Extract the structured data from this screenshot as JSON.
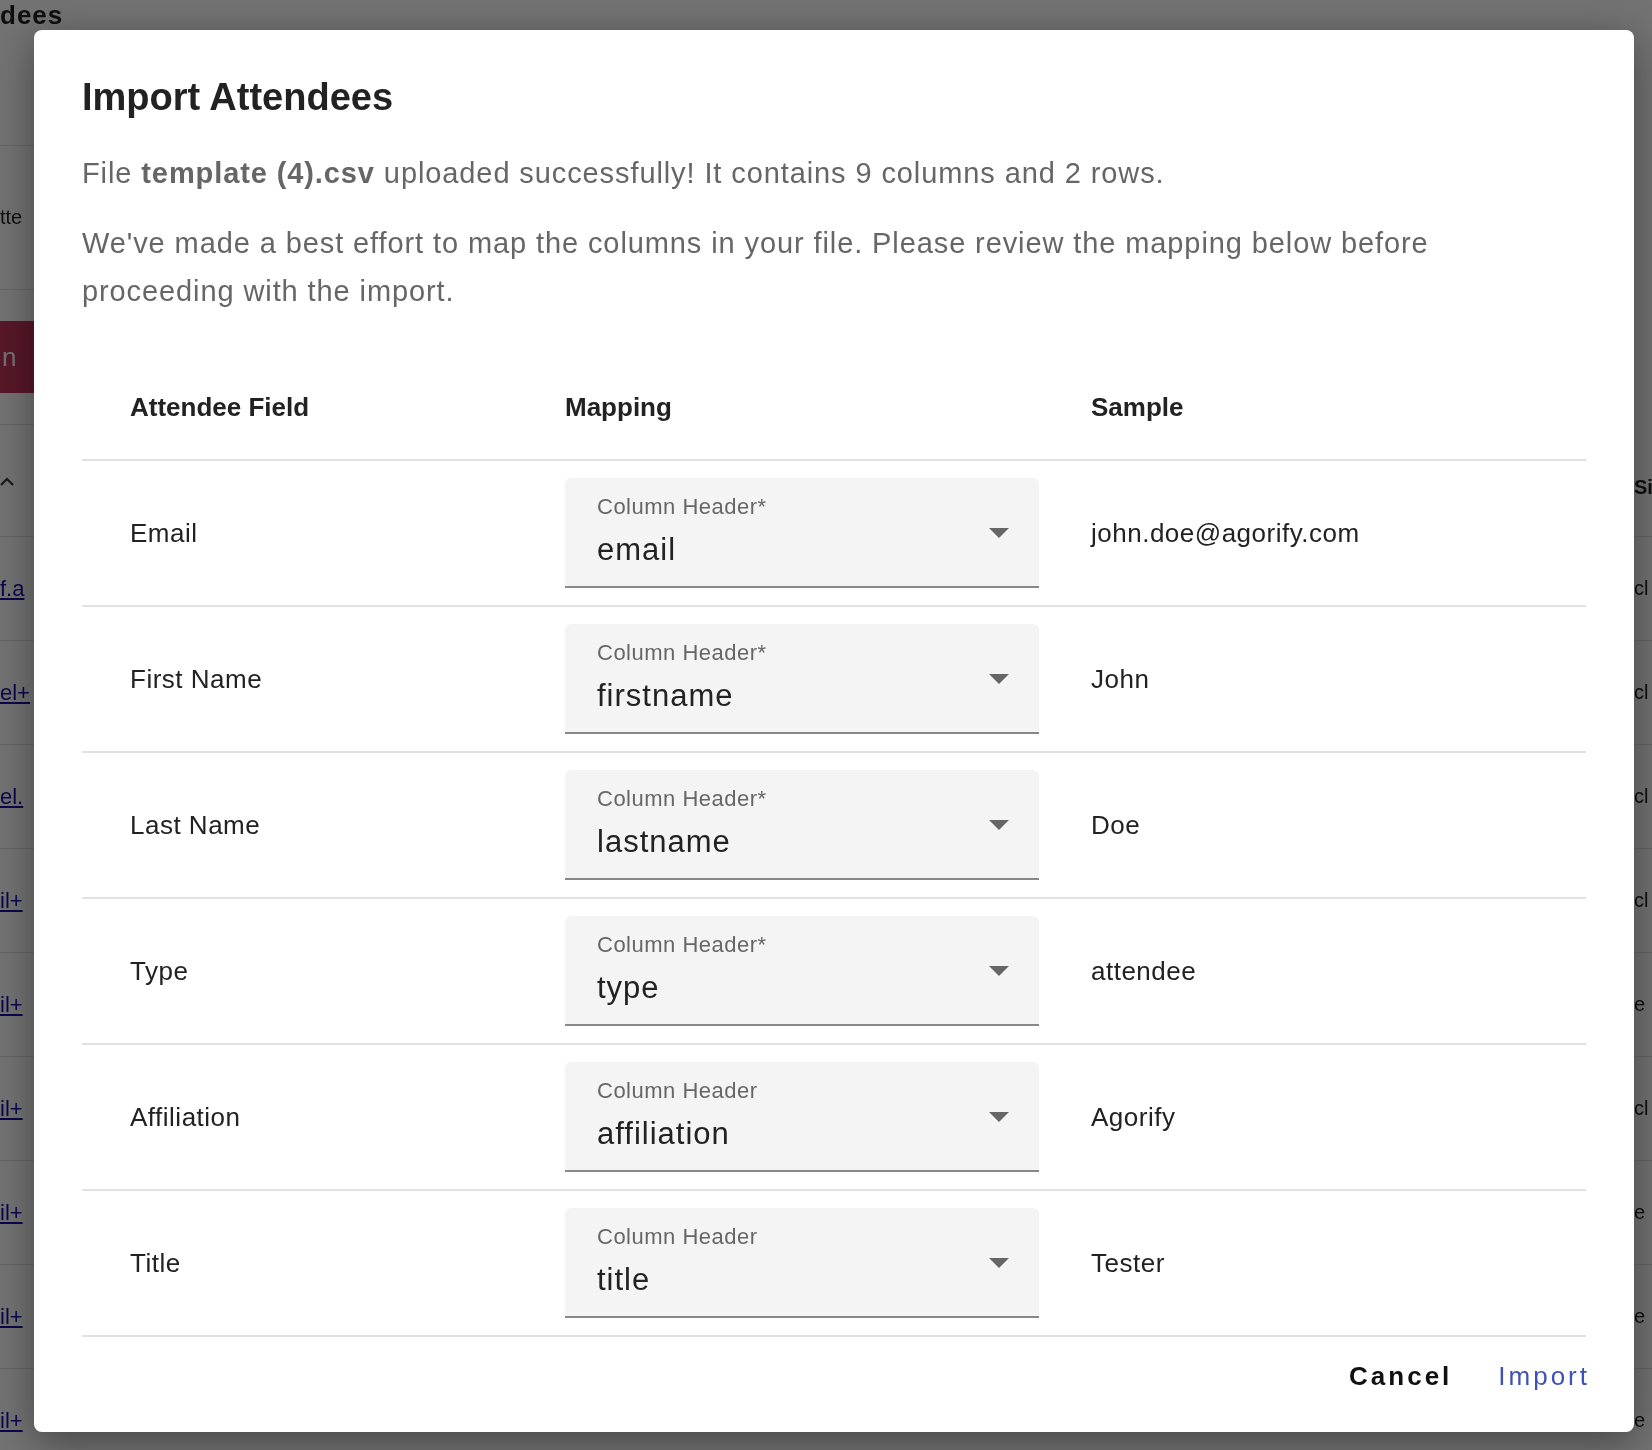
{
  "background": {
    "left": [
      {
        "kind": "heading",
        "text": "dees"
      },
      {
        "kind": "text",
        "text": "tte"
      },
      {
        "kind": "button",
        "text": "n"
      },
      {
        "kind": "chevron"
      },
      {
        "kind": "link",
        "text": "f.a"
      },
      {
        "kind": "link",
        "text": "el+"
      },
      {
        "kind": "link",
        "text": "el."
      },
      {
        "kind": "link",
        "text": "il+"
      },
      {
        "kind": "link",
        "text": "il+"
      },
      {
        "kind": "link",
        "text": "il+"
      },
      {
        "kind": "link",
        "text": "il+"
      },
      {
        "kind": "link",
        "text": "il+"
      },
      {
        "kind": "link",
        "text": "il+"
      }
    ],
    "right": [
      {
        "kind": "header",
        "text": "Si"
      },
      {
        "kind": "text",
        "text": "cl"
      },
      {
        "kind": "text",
        "text": "cl"
      },
      {
        "kind": "text",
        "text": "cl"
      },
      {
        "kind": "text",
        "text": "cl"
      },
      {
        "kind": "text",
        "text": "e"
      },
      {
        "kind": "text",
        "text": "cl"
      },
      {
        "kind": "text",
        "text": "e"
      },
      {
        "kind": "text",
        "text": "e"
      },
      {
        "kind": "text",
        "text": "e"
      }
    ]
  },
  "dialog": {
    "title": "Import Attendees",
    "message": "File **template (4).csv** uploaded successfully! It contains 9 columns and 2 rows.",
    "note": "We've made a best effort to map the columns in your file. Please review the mapping below before proceeding with the import.",
    "columns": [
      "Attendee Field",
      "Mapping",
      "Sample"
    ],
    "rows": [
      {
        "field": "Email",
        "label": "Column Header*",
        "value": "email",
        "sample": "john.doe@agorify.com"
      },
      {
        "field": "First Name",
        "label": "Column Header*",
        "value": "firstname",
        "sample": "John"
      },
      {
        "field": "Last Name",
        "label": "Column Header*",
        "value": "lastname",
        "sample": "Doe"
      },
      {
        "field": "Type",
        "label": "Column Header*",
        "value": "type",
        "sample": "attendee"
      },
      {
        "field": "Affiliation",
        "label": "Column Header",
        "value": "affiliation",
        "sample": "Agorify"
      },
      {
        "field": "Title",
        "label": "Column Header",
        "value": "title",
        "sample": "Tester"
      }
    ],
    "buttons": [
      {
        "label": "Cancel",
        "kind": "secondary"
      },
      {
        "label": "Import",
        "kind": "primary"
      }
    ]
  }
}
